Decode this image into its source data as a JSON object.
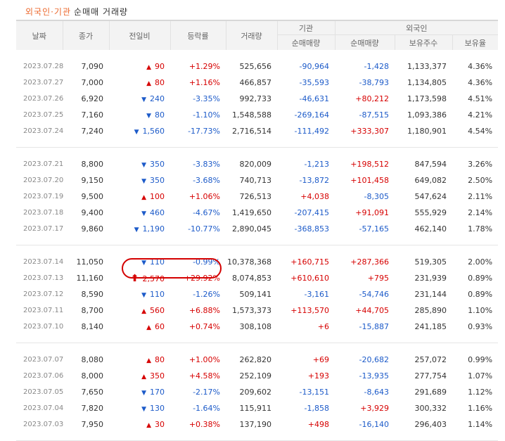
{
  "title": {
    "part1": "외국인·기관",
    "part2": "순매매 거래량"
  },
  "colors": {
    "up": "#d60000",
    "down": "#1d5bc9",
    "accent": "#ec6a2f",
    "highlight_circle": "#d40000"
  },
  "headers": {
    "date": "날짜",
    "close": "종가",
    "change": "전일비",
    "rate": "등락률",
    "volume": "거래량",
    "inst_group": "기관",
    "inst_net": "순매매량",
    "foreign_group": "외국인",
    "foreign_net": "순매매량",
    "foreign_hold": "보유주수",
    "foreign_ratio": "보유율"
  },
  "groups": [
    {
      "rows": [
        {
          "date": "2023.07.28",
          "close": "7,090",
          "dir": "up",
          "change": "90",
          "rate": "+1.29%",
          "volume": "525,656",
          "inst": "-90,964",
          "foreign": "-1,428",
          "hold": "1,133,377",
          "ratio": "4.36%"
        },
        {
          "date": "2023.07.27",
          "close": "7,000",
          "dir": "up",
          "change": "80",
          "rate": "+1.16%",
          "volume": "466,857",
          "inst": "-35,593",
          "foreign": "-38,793",
          "hold": "1,134,805",
          "ratio": "4.36%"
        },
        {
          "date": "2023.07.26",
          "close": "6,920",
          "dir": "down",
          "change": "240",
          "rate": "-3.35%",
          "volume": "992,733",
          "inst": "-46,631",
          "foreign": "+80,212",
          "hold": "1,173,598",
          "ratio": "4.51%"
        },
        {
          "date": "2023.07.25",
          "close": "7,160",
          "dir": "down",
          "change": "80",
          "rate": "-1.10%",
          "volume": "1,548,588",
          "inst": "-269,164",
          "foreign": "-87,515",
          "hold": "1,093,386",
          "ratio": "4.21%"
        },
        {
          "date": "2023.07.24",
          "close": "7,240",
          "dir": "down",
          "change": "1,560",
          "rate": "-17.73%",
          "volume": "2,716,514",
          "inst": "-111,492",
          "foreign": "+333,307",
          "hold": "1,180,901",
          "ratio": "4.54%"
        }
      ]
    },
    {
      "rows": [
        {
          "date": "2023.07.21",
          "close": "8,800",
          "dir": "down",
          "change": "350",
          "rate": "-3.83%",
          "volume": "820,009",
          "inst": "-1,213",
          "foreign": "+198,512",
          "hold": "847,594",
          "ratio": "3.26%"
        },
        {
          "date": "2023.07.20",
          "close": "9,150",
          "dir": "down",
          "change": "350",
          "rate": "-3.68%",
          "volume": "740,713",
          "inst": "-13,872",
          "foreign": "+101,458",
          "hold": "649,082",
          "ratio": "2.50%"
        },
        {
          "date": "2023.07.19",
          "close": "9,500",
          "dir": "up",
          "change": "100",
          "rate": "+1.06%",
          "volume": "726,513",
          "inst": "+4,038",
          "foreign": "-8,305",
          "hold": "547,624",
          "ratio": "2.11%"
        },
        {
          "date": "2023.07.18",
          "close": "9,400",
          "dir": "down",
          "change": "460",
          "rate": "-4.67%",
          "volume": "1,419,650",
          "inst": "-207,415",
          "foreign": "+91,091",
          "hold": "555,929",
          "ratio": "2.14%"
        },
        {
          "date": "2023.07.17",
          "close": "9,860",
          "dir": "down",
          "change": "1,190",
          "rate": "-10.77%",
          "volume": "2,890,045",
          "inst": "-368,853",
          "foreign": "-57,165",
          "hold": "462,140",
          "ratio": "1.78%"
        }
      ]
    },
    {
      "rows": [
        {
          "date": "2023.07.14",
          "close": "11,050",
          "dir": "down",
          "change": "110",
          "rate": "-0.99%",
          "volume": "10,378,368",
          "inst": "+160,715",
          "foreign": "+287,366",
          "hold": "519,305",
          "ratio": "2.00%"
        },
        {
          "date": "2023.07.13",
          "close": "11,160",
          "dir": "upper",
          "change": "2,570",
          "rate": "+29.92%",
          "volume": "8,074,853",
          "inst": "+610,610",
          "foreign": "+795",
          "hold": "231,939",
          "ratio": "0.89%"
        },
        {
          "date": "2023.07.12",
          "close": "8,590",
          "dir": "down",
          "change": "110",
          "rate": "-1.26%",
          "volume": "509,141",
          "inst": "-3,161",
          "foreign": "-54,746",
          "hold": "231,144",
          "ratio": "0.89%"
        },
        {
          "date": "2023.07.11",
          "close": "8,700",
          "dir": "up",
          "change": "560",
          "rate": "+6.88%",
          "volume": "1,573,373",
          "inst": "+113,570",
          "foreign": "+44,705",
          "hold": "285,890",
          "ratio": "1.10%"
        },
        {
          "date": "2023.07.10",
          "close": "8,140",
          "dir": "up",
          "change": "60",
          "rate": "+0.74%",
          "volume": "308,108",
          "inst": "+6",
          "foreign": "-15,887",
          "hold": "241,185",
          "ratio": "0.93%"
        }
      ]
    },
    {
      "rows": [
        {
          "date": "2023.07.07",
          "close": "8,080",
          "dir": "up",
          "change": "80",
          "rate": "+1.00%",
          "volume": "262,820",
          "inst": "+69",
          "foreign": "-20,682",
          "hold": "257,072",
          "ratio": "0.99%"
        },
        {
          "date": "2023.07.06",
          "close": "8,000",
          "dir": "up",
          "change": "350",
          "rate": "+4.58%",
          "volume": "252,109",
          "inst": "+193",
          "foreign": "-13,935",
          "hold": "277,754",
          "ratio": "1.07%"
        },
        {
          "date": "2023.07.05",
          "close": "7,650",
          "dir": "down",
          "change": "170",
          "rate": "-2.17%",
          "volume": "209,602",
          "inst": "-13,151",
          "foreign": "-8,643",
          "hold": "291,689",
          "ratio": "1.12%"
        },
        {
          "date": "2023.07.04",
          "close": "7,820",
          "dir": "down",
          "change": "130",
          "rate": "-1.64%",
          "volume": "115,911",
          "inst": "-1,858",
          "foreign": "+3,929",
          "hold": "300,332",
          "ratio": "1.16%"
        },
        {
          "date": "2023.07.03",
          "close": "7,950",
          "dir": "up",
          "change": "30",
          "rate": "+0.38%",
          "volume": "137,190",
          "inst": "+498",
          "foreign": "-16,140",
          "hold": "296,403",
          "ratio": "1.14%"
        }
      ]
    }
  ]
}
